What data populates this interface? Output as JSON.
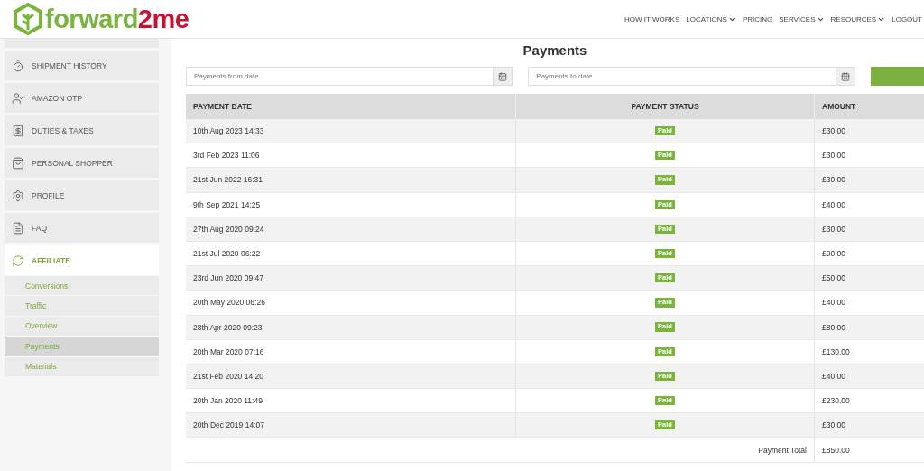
{
  "logo": {
    "text_main": "forward",
    "text_accent": "2me"
  },
  "nav": [
    {
      "label": "HOW IT WORKS",
      "dropdown": false
    },
    {
      "label": "LOCATIONS",
      "dropdown": true
    },
    {
      "label": "PRICING",
      "dropdown": false
    },
    {
      "label": "SERVICES",
      "dropdown": true
    },
    {
      "label": "RESOURCES",
      "dropdown": true
    },
    {
      "label": "LOGOUT",
      "dropdown": false
    }
  ],
  "sidebar": {
    "items": [
      {
        "label": "SHIPMENT HISTORY",
        "selected": false
      },
      {
        "label": "AMAZON OTP",
        "selected": false
      },
      {
        "label": "DUTIES & TAXES",
        "selected": false
      },
      {
        "label": "PERSONAL SHOPPER",
        "selected": false
      },
      {
        "label": "PROFILE",
        "selected": false
      },
      {
        "label": "FAQ",
        "selected": false
      },
      {
        "label": "AFFILIATE",
        "selected": true,
        "children": [
          {
            "label": "Conversions",
            "selected": false
          },
          {
            "label": "Traffic",
            "selected": false
          },
          {
            "label": "Overview",
            "selected": false
          },
          {
            "label": "Payments",
            "selected": true
          },
          {
            "label": "Materials",
            "selected": false
          }
        ]
      }
    ]
  },
  "page_title": "Payments",
  "filters": [
    {
      "placeholder": "Payments from date"
    },
    {
      "placeholder": "Payments to date"
    }
  ],
  "table": {
    "columns": [
      "PAYMENT DATE",
      "PAYMENT STATUS",
      "AMOUNT"
    ],
    "rows": [
      {
        "date": "10th Aug 2023 14:33",
        "status": "Paid",
        "amount": "£30.00"
      },
      {
        "date": "3rd Feb 2023 11:06",
        "status": "Paid",
        "amount": "£30.00"
      },
      {
        "date": "21st Jun 2022 16:31",
        "status": "Paid",
        "amount": "£30.00"
      },
      {
        "date": "9th Sep 2021 14:25",
        "status": "Paid",
        "amount": "£40.00"
      },
      {
        "date": "27th Aug 2020 09:24",
        "status": "Paid",
        "amount": "£30.00"
      },
      {
        "date": "21st Jul 2020 06:22",
        "status": "Paid",
        "amount": "£90.00"
      },
      {
        "date": "23rd Jun 2020 09:47",
        "status": "Paid",
        "amount": "£50.00"
      },
      {
        "date": "20th May 2020 06:26",
        "status": "Paid",
        "amount": "£40.00"
      },
      {
        "date": "28th Apr 2020 09:23",
        "status": "Paid",
        "amount": "£80.00"
      },
      {
        "date": "20th Mar 2020 07:16",
        "status": "Paid",
        "amount": "£130.00"
      },
      {
        "date": "21st Feb 2020 14:20",
        "status": "Paid",
        "amount": "£40.00"
      },
      {
        "date": "20th Jan 2020 11:49",
        "status": "Paid",
        "amount": "£230.00"
      },
      {
        "date": "20th Dec 2019 14:07",
        "status": "Paid",
        "amount": "£30.00"
      }
    ],
    "total_label": "Payment Total",
    "total_amount": "£850.00"
  }
}
